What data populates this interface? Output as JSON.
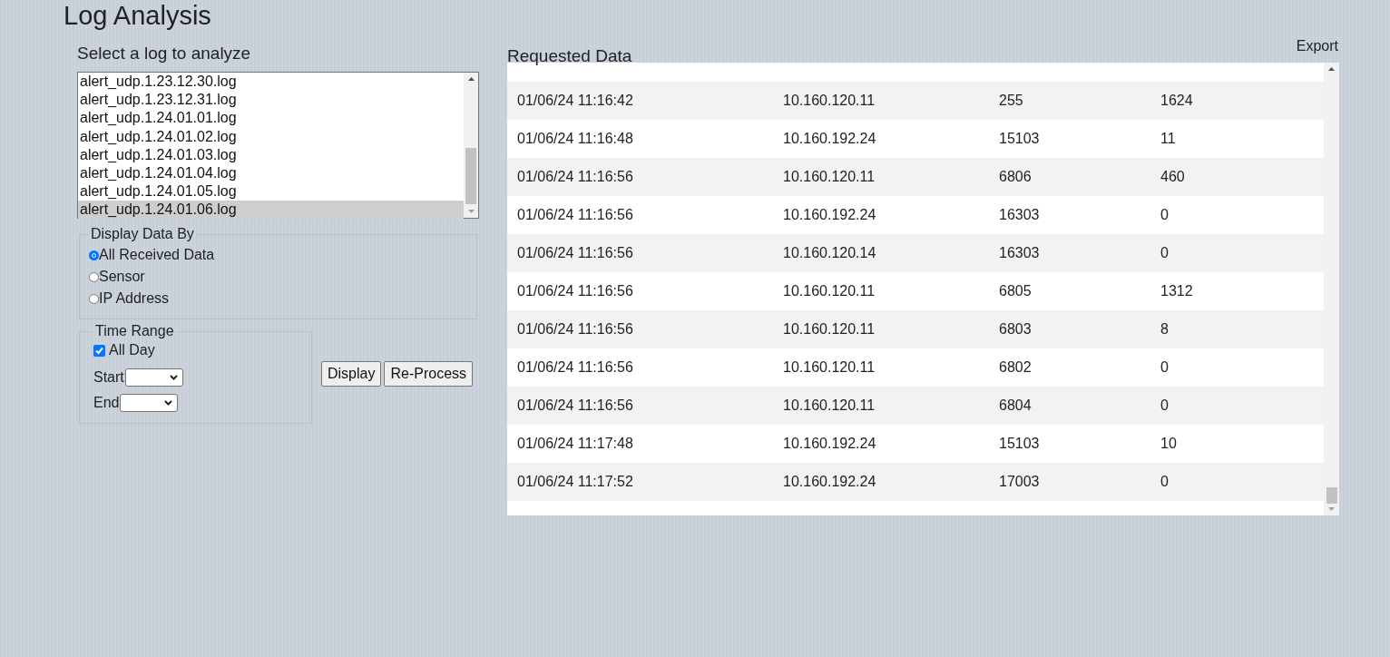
{
  "title": "Log Analysis",
  "log_select": {
    "label": "Select a log to analyze",
    "items": [
      {
        "name": "alert_udp.1.23.12.30.log",
        "selected": false
      },
      {
        "name": "alert_udp.1.23.12.31.log",
        "selected": false
      },
      {
        "name": "alert_udp.1.24.01.01.log",
        "selected": false
      },
      {
        "name": "alert_udp.1.24.01.02.log",
        "selected": false
      },
      {
        "name": "alert_udp.1.24.01.03.log",
        "selected": false
      },
      {
        "name": "alert_udp.1.24.01.04.log",
        "selected": false
      },
      {
        "name": "alert_udp.1.24.01.05.log",
        "selected": false
      },
      {
        "name": "alert_udp.1.24.01.06.log",
        "selected": true
      }
    ]
  },
  "display_by": {
    "legend": "Display Data By",
    "options": [
      {
        "label": "All Received Data",
        "selected": true
      },
      {
        "label": "Sensor",
        "selected": false
      },
      {
        "label": "IP Address",
        "selected": false
      }
    ]
  },
  "time_range": {
    "legend": "Time Range",
    "all_day": {
      "label": "All Day",
      "checked": true
    },
    "start": {
      "label": "Start"
    },
    "end": {
      "label": "End"
    }
  },
  "buttons": [
    "Display",
    "Re-Process"
  ],
  "requested_data": {
    "title": "Requested Data",
    "export": "Export",
    "rows": [
      [
        "01/06/24 11:16:42",
        "10.160.120.11",
        "255",
        "1624"
      ],
      [
        "01/06/24 11:16:48",
        "10.160.192.24",
        "15103",
        "11"
      ],
      [
        "01/06/24 11:16:56",
        "10.160.120.11",
        "6806",
        "460"
      ],
      [
        "01/06/24 11:16:56",
        "10.160.192.24",
        "16303",
        "0"
      ],
      [
        "01/06/24 11:16:56",
        "10.160.120.14",
        "16303",
        "0"
      ],
      [
        "01/06/24 11:16:56",
        "10.160.120.11",
        "6805",
        "1312"
      ],
      [
        "01/06/24 11:16:56",
        "10.160.120.11",
        "6803",
        "8"
      ],
      [
        "01/06/24 11:16:56",
        "10.160.120.11",
        "6802",
        "0"
      ],
      [
        "01/06/24 11:16:56",
        "10.160.120.11",
        "6804",
        "0"
      ],
      [
        "01/06/24 11:17:48",
        "10.160.192.24",
        "15103",
        "10"
      ],
      [
        "01/06/24 11:17:52",
        "10.160.192.24",
        "17003",
        "0"
      ]
    ]
  }
}
